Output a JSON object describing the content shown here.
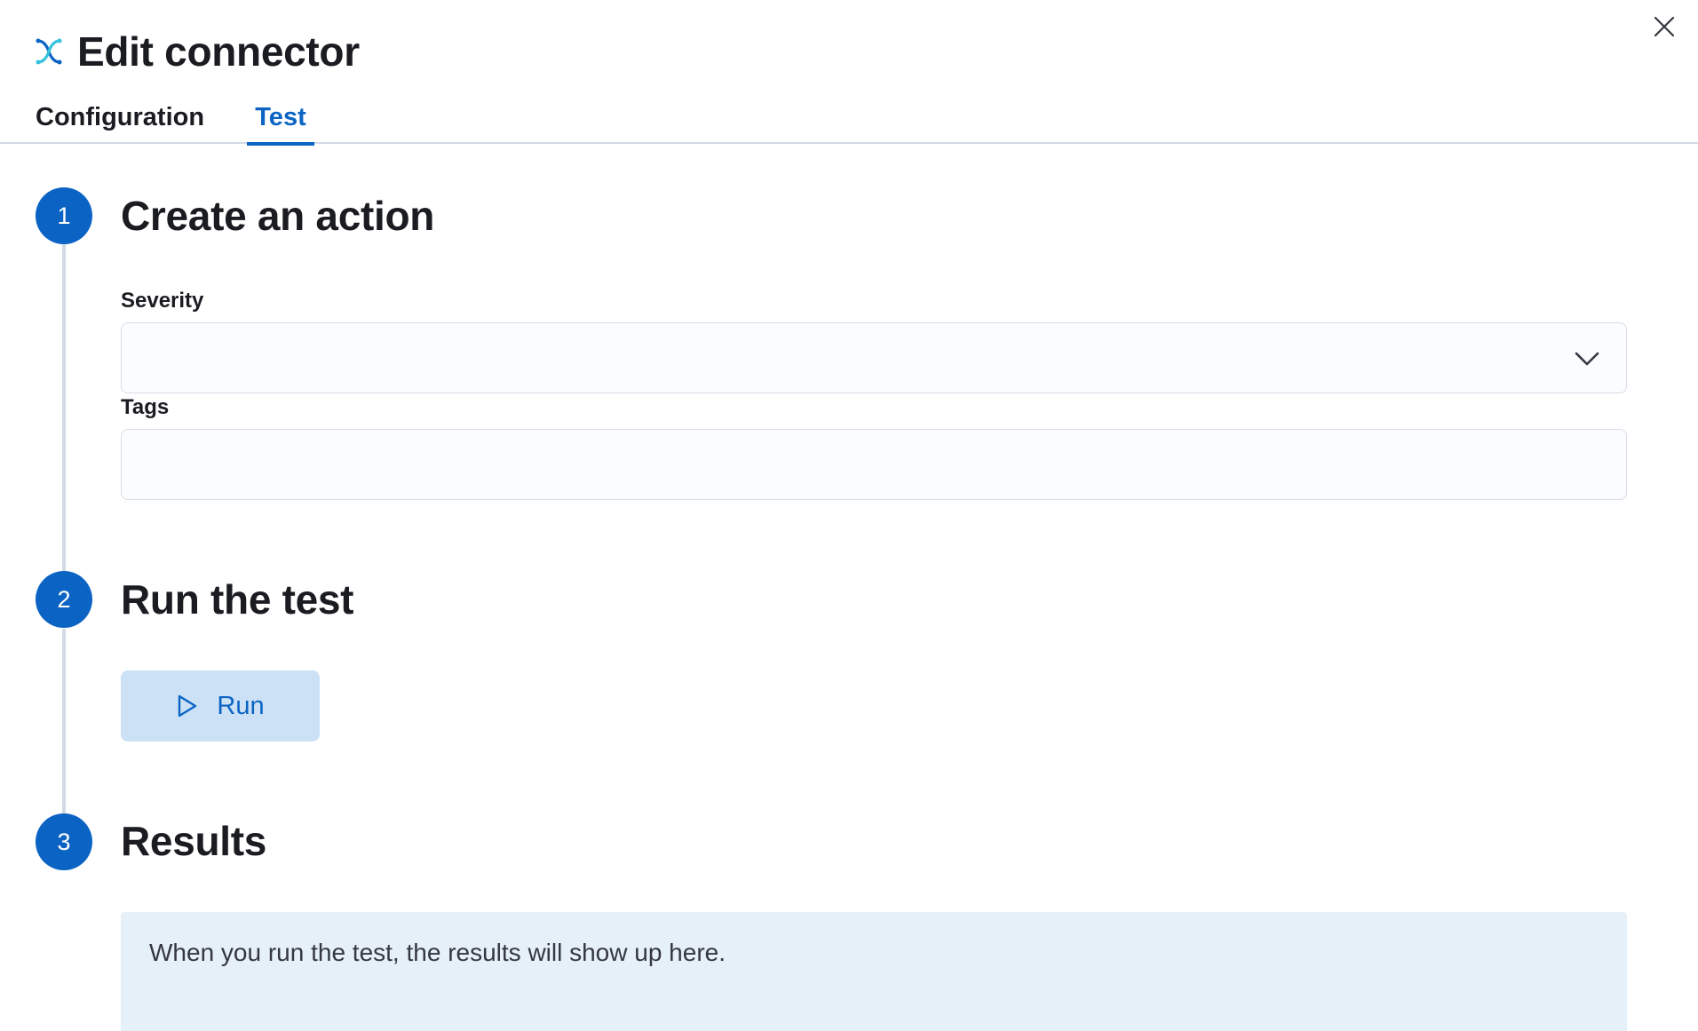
{
  "header": {
    "title": "Edit connector",
    "close_icon": "close-icon",
    "logo_icon": "connector-logo-icon"
  },
  "tabs": [
    {
      "label": "Configuration",
      "selected": false
    },
    {
      "label": "Test",
      "selected": true
    }
  ],
  "colors": {
    "accent": "#0b64c4",
    "step_line": "#d3dae6",
    "run_button_bg": "#cce1f5",
    "results_bg": "#e6f0f8"
  },
  "steps": [
    {
      "number": "1",
      "title": "Create an action"
    },
    {
      "number": "2",
      "title": "Run the test"
    },
    {
      "number": "3",
      "title": "Results"
    }
  ],
  "form": {
    "severity": {
      "label": "Severity",
      "value": ""
    },
    "tags": {
      "label": "Tags",
      "value": ""
    }
  },
  "run_button": {
    "label": "Run",
    "icon": "play-icon"
  },
  "results": {
    "message": "When you run the test, the results will show up here."
  }
}
